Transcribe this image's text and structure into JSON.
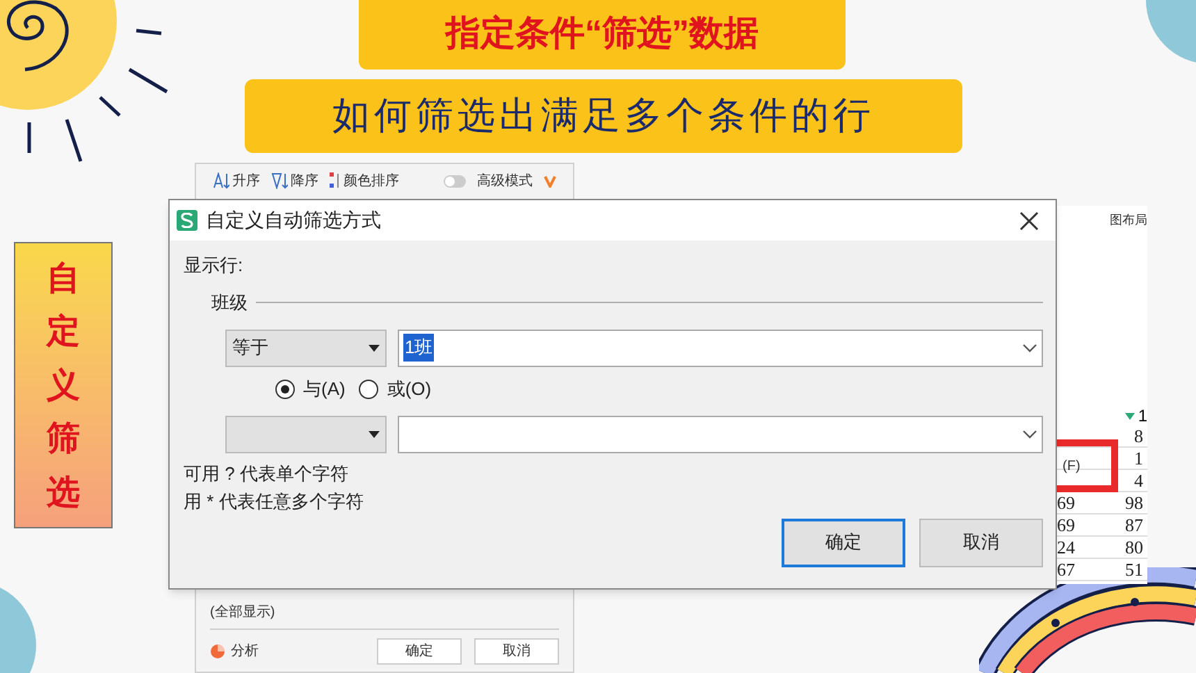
{
  "slide": {
    "title": "指定条件“筛选”数据",
    "subtitle": "如何筛选出满足多个条件的行",
    "side_label": "自定义筛选"
  },
  "filter_panel": {
    "toolbar": [
      {
        "kind": "asc",
        "label": "升序"
      },
      {
        "kind": "desc",
        "label": "降序"
      },
      {
        "kind": "color",
        "label": "颜色排序"
      }
    ],
    "advanced_mode": {
      "label": "高级模式",
      "on": false
    },
    "show_all": "(全部显示)",
    "analyze": "分析",
    "buttons": [
      {
        "label": "确定"
      },
      {
        "label": "取消"
      }
    ]
  },
  "sheet": {
    "ribbon_label": "图布局",
    "header": "1",
    "menu_hint": "(F)",
    "rows": [
      [
        "",
        "8"
      ],
      [
        "",
        "1"
      ],
      [
        "",
        "4"
      ],
      [
        "69",
        "98"
      ],
      [
        "69",
        "87"
      ],
      [
        "24",
        "80"
      ],
      [
        "67",
        "51"
      ]
    ]
  },
  "dialog": {
    "title": "自定义自动筛选方式",
    "section": "显示行:",
    "field": "班级",
    "conditions": [
      {
        "kind": "primary",
        "operator": "等于",
        "value": "1班",
        "value_selected": true
      },
      {
        "kind": "secondary"
      }
    ],
    "logic": [
      {
        "label": "与(A)",
        "selected": true
      },
      {
        "label": "或(O)",
        "selected": false
      }
    ],
    "hints": [
      "可用 ? 代表单个字符",
      "用 * 代表任意多个字符"
    ],
    "buttons": [
      {
        "label": "确定",
        "focused": true
      },
      {
        "label": "取消",
        "focused": false
      }
    ]
  }
}
